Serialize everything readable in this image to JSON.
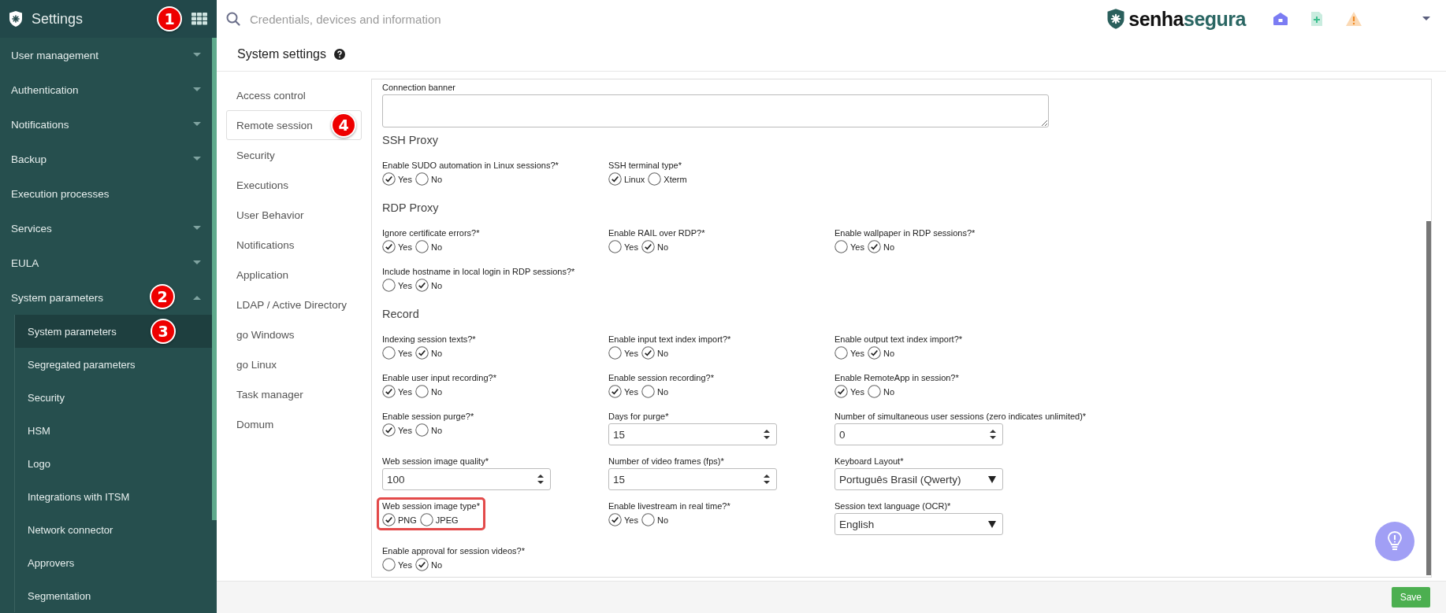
{
  "sidebar": {
    "title": "Settings",
    "badge": "1",
    "items": [
      {
        "label": "User management",
        "expanded": false
      },
      {
        "label": "Authentication",
        "expanded": false
      },
      {
        "label": "Notifications",
        "expanded": false
      },
      {
        "label": "Backup",
        "expanded": false
      },
      {
        "label": "Execution processes"
      },
      {
        "label": "Services",
        "expanded": false
      },
      {
        "label": "EULA",
        "expanded": false
      },
      {
        "label": "System parameters",
        "expanded": true,
        "badge": "2",
        "children": [
          {
            "label": "System parameters",
            "selected": true,
            "badge": "3"
          },
          {
            "label": "Segregated parameters",
            "selected": false
          },
          {
            "label": "Security",
            "selected": false
          },
          {
            "label": "HSM",
            "selected": false
          },
          {
            "label": "Logo",
            "selected": false
          },
          {
            "label": "Integrations with ITSM",
            "selected": false
          },
          {
            "label": "Network connector",
            "selected": false
          },
          {
            "label": "Approvers",
            "selected": false
          },
          {
            "label": "Segmentation",
            "selected": false
          }
        ]
      }
    ]
  },
  "search": {
    "placeholder": "Credentials, devices and information"
  },
  "logo": {
    "text_1": "senha",
    "text_2": "segura"
  },
  "page_title": "System settings",
  "subnav": [
    {
      "label": "Access control",
      "selected": false
    },
    {
      "label": "Remote session",
      "selected": true,
      "badge": "4"
    },
    {
      "label": "Security",
      "selected": false
    },
    {
      "label": "Executions",
      "selected": false
    },
    {
      "label": "User Behavior",
      "selected": false
    },
    {
      "label": "Notifications",
      "selected": false
    },
    {
      "label": "Application",
      "selected": false
    },
    {
      "label": "LDAP / Active Directory",
      "selected": false
    },
    {
      "label": "go Windows",
      "selected": false
    },
    {
      "label": "go Linux",
      "selected": false
    },
    {
      "label": "Task manager",
      "selected": false
    },
    {
      "label": "Domum",
      "selected": false
    }
  ],
  "banner": {
    "label": "Connection banner"
  },
  "sections": [
    {
      "title": "SSH Proxy",
      "fields": [
        {
          "kind": "radio",
          "label": "Enable SUDO automation in Linux sessions?*",
          "highlighted": false,
          "options": [
            {
              "label": "Yes",
              "selected": true
            },
            {
              "label": "No",
              "selected": false
            }
          ]
        },
        {
          "kind": "radio",
          "label": "SSH terminal type*",
          "highlighted": false,
          "options": [
            {
              "label": "Linux",
              "selected": true
            },
            {
              "label": "Xterm",
              "selected": false
            }
          ]
        }
      ]
    },
    {
      "title": "RDP Proxy",
      "fields": [
        {
          "kind": "radio",
          "label": "Ignore certificate errors?*",
          "highlighted": false,
          "options": [
            {
              "label": "Yes",
              "selected": true
            },
            {
              "label": "No",
              "selected": false
            }
          ]
        },
        {
          "kind": "radio",
          "label": "Enable RAIL over RDP?*",
          "highlighted": false,
          "options": [
            {
              "label": "Yes",
              "selected": false
            },
            {
              "label": "No",
              "selected": true
            }
          ]
        },
        {
          "kind": "radio",
          "label": "Enable wallpaper in RDP sessions?*",
          "highlighted": false,
          "options": [
            {
              "label": "Yes",
              "selected": false
            },
            {
              "label": "No",
              "selected": true
            }
          ]
        },
        {
          "kind": "radio",
          "label": "Include hostname in local login in RDP sessions?*",
          "highlighted": false,
          "options": [
            {
              "label": "Yes",
              "selected": false
            },
            {
              "label": "No",
              "selected": true
            }
          ]
        }
      ]
    },
    {
      "title": "Record",
      "fields": [
        {
          "kind": "radio",
          "label": "Indexing session texts?*",
          "highlighted": false,
          "options": [
            {
              "label": "Yes",
              "selected": false
            },
            {
              "label": "No",
              "selected": true
            }
          ]
        },
        {
          "kind": "radio",
          "label": "Enable input text index import?*",
          "highlighted": false,
          "options": [
            {
              "label": "Yes",
              "selected": false
            },
            {
              "label": "No",
              "selected": true
            }
          ]
        },
        {
          "kind": "radio",
          "label": "Enable output text index import?*",
          "highlighted": false,
          "options": [
            {
              "label": "Yes",
              "selected": false
            },
            {
              "label": "No",
              "selected": true
            }
          ]
        },
        {
          "kind": "radio",
          "label": "Enable user input recording?*",
          "highlighted": false,
          "options": [
            {
              "label": "Yes",
              "selected": true
            },
            {
              "label": "No",
              "selected": false
            }
          ]
        },
        {
          "kind": "radio",
          "label": "Enable session recording?*",
          "highlighted": false,
          "options": [
            {
              "label": "Yes",
              "selected": true
            },
            {
              "label": "No",
              "selected": false
            }
          ]
        },
        {
          "kind": "radio",
          "label": "Enable RemoteApp in session?*",
          "highlighted": false,
          "options": [
            {
              "label": "Yes",
              "selected": true
            },
            {
              "label": "No",
              "selected": false
            }
          ]
        },
        {
          "kind": "radio",
          "label": "Enable session purge?*",
          "highlighted": false,
          "options": [
            {
              "label": "Yes",
              "selected": true
            },
            {
              "label": "No",
              "selected": false
            }
          ]
        },
        {
          "kind": "number",
          "label": "Days for purge*",
          "highlighted": false,
          "value": "15"
        },
        {
          "kind": "number",
          "label": "Number of simultaneous user sessions (zero indicates unlimited)*",
          "highlighted": false,
          "value": "0"
        },
        {
          "kind": "number",
          "label": "Web session image quality*",
          "highlighted": false,
          "value": "100"
        },
        {
          "kind": "number",
          "label": "Number of video frames (fps)*",
          "highlighted": false,
          "value": "15"
        },
        {
          "kind": "select",
          "label": "Keyboard Layout*",
          "highlighted": false,
          "value": "Português Brasil (Qwerty)"
        },
        {
          "kind": "radio",
          "label": "Web session image type*",
          "highlighted": true,
          "options": [
            {
              "label": "PNG",
              "selected": true
            },
            {
              "label": "JPEG",
              "selected": false
            }
          ]
        },
        {
          "kind": "radio",
          "label": "Enable livestream in real time?*",
          "highlighted": false,
          "options": [
            {
              "label": "Yes",
              "selected": true
            },
            {
              "label": "No",
              "selected": false
            }
          ]
        },
        {
          "kind": "select",
          "label": "Session text language (OCR)*",
          "highlighted": false,
          "value": "English"
        },
        {
          "kind": "radio",
          "label": "Enable approval for session videos?*",
          "highlighted": false,
          "options": [
            {
              "label": "Yes",
              "selected": false
            },
            {
              "label": "No",
              "selected": true
            }
          ]
        }
      ]
    }
  ],
  "save_button": "Save"
}
